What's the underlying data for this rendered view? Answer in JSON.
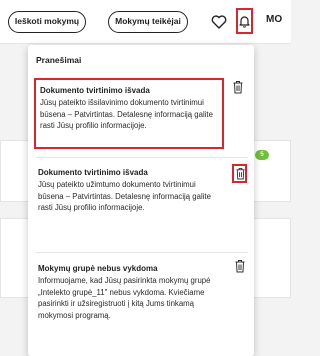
{
  "header": {
    "search_label": "Ieškoti mokymų",
    "teachers_label": "Mokymų teikėjai",
    "user_initials": "MO"
  },
  "background": {
    "badge_text": "5"
  },
  "notifications": {
    "title": "Pranešimai",
    "items": [
      {
        "title": "Dokumento tvirtinimo išvada",
        "body": "Jūsų pateikto išsilavinimo dokumento tvirtinimui būsena – Patvirtintas. Detalesnę informaciją galite rasti Jūsų profilio informacijoje."
      },
      {
        "title": "Dokumento tvirtinimo išvada",
        "body": "Jūsų pateikto užimtumo dokumento tvirtinimui būsena – Patvirtintas. Detalesnę informaciją galite rasti Jūsų profilio informacijoje."
      },
      {
        "title": "Mokymų grupė nebus vykdoma",
        "body": "Informuojame, kad Jūsų pasirinkta mokymų grupė „Intelekto grupė_11\" nebus vykdoma. Kviečiame pasirinkti ir užsiregistruoti į kitą Jums tinkamą mokymosi programą."
      }
    ]
  },
  "colors": {
    "highlight": "#d7262d",
    "badge": "#6fbf3a"
  }
}
